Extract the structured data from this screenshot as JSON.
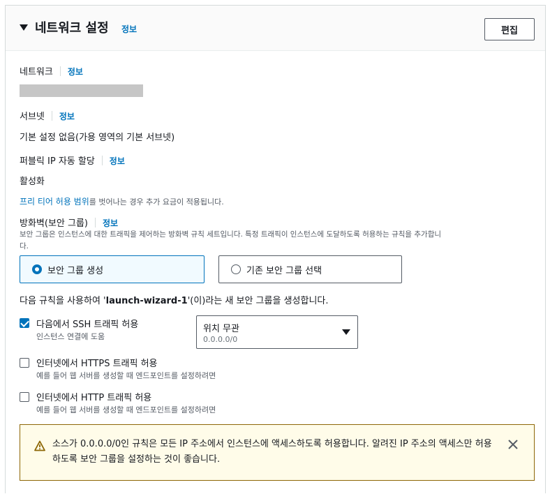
{
  "header": {
    "title": "네트워크 설정",
    "info": "정보",
    "edit_label": "편집"
  },
  "network": {
    "label": "네트워크",
    "info": "정보"
  },
  "subnet": {
    "label": "서브넷",
    "info": "정보",
    "value": "기본 설정 없음(가용 영역의 기본 서브넷)"
  },
  "public_ip": {
    "label": "퍼블릭 IP 자동 할당",
    "info": "정보",
    "value": "활성화",
    "note_link": "프리 티어 허용 범위",
    "note_text": "를 벗어나는 경우 추가 요금이 적용됩니다."
  },
  "firewall": {
    "label": "방화벽(보안 그룹)",
    "info": "정보",
    "desc_line1": "보안 그룹은 인스턴스에 대한 트래픽을 제어하는 방화벽 규칙 세트입니다. 특정 트래픽이 인스턴스에 도달하도록 허용하는 규칙을 추가합니",
    "desc_line2": "다.",
    "option_create": "보안 그룹 생성",
    "option_existing": "기존 보안 그룹 선택",
    "rule_prefix": "다음 규칙을 사용하여 '",
    "rule_name": "launch-wizard-1",
    "rule_suffix": "'(이)라는 새 보안 그룹을 생성합니다."
  },
  "rules": {
    "ssh": {
      "label": "다음에서 SSH 트래픽 허용",
      "desc": "인스턴스 연결에 도움",
      "checked": true
    },
    "https": {
      "label": "인터넷에서 HTTPS 트래픽 허용",
      "desc": "예를 들어 웹 서버를 생성할 때 엔드포인트를 설정하려면",
      "checked": false
    },
    "http": {
      "label": "인터넷에서 HTTP 트래픽 허용",
      "desc": "예를 들어 웹 서버를 생성할 때 엔드포인트를 설정하려면",
      "checked": false
    },
    "source_select": {
      "value": "위치 무관",
      "sub": "0.0.0.0/0"
    }
  },
  "warning": {
    "text": "소스가 0.0.0.0/0인 규칙은 모든 IP 주소에서 인스턴스에 액세스하도록 허용합니다. 알려진 IP 주소의 액세스만 허용하도록 보안 그룹을 설정하는 것이 좋습니다."
  },
  "colors": {
    "link": "#0073bb",
    "warning_border": "#8d6605",
    "warning_bg": "#fffce9"
  }
}
